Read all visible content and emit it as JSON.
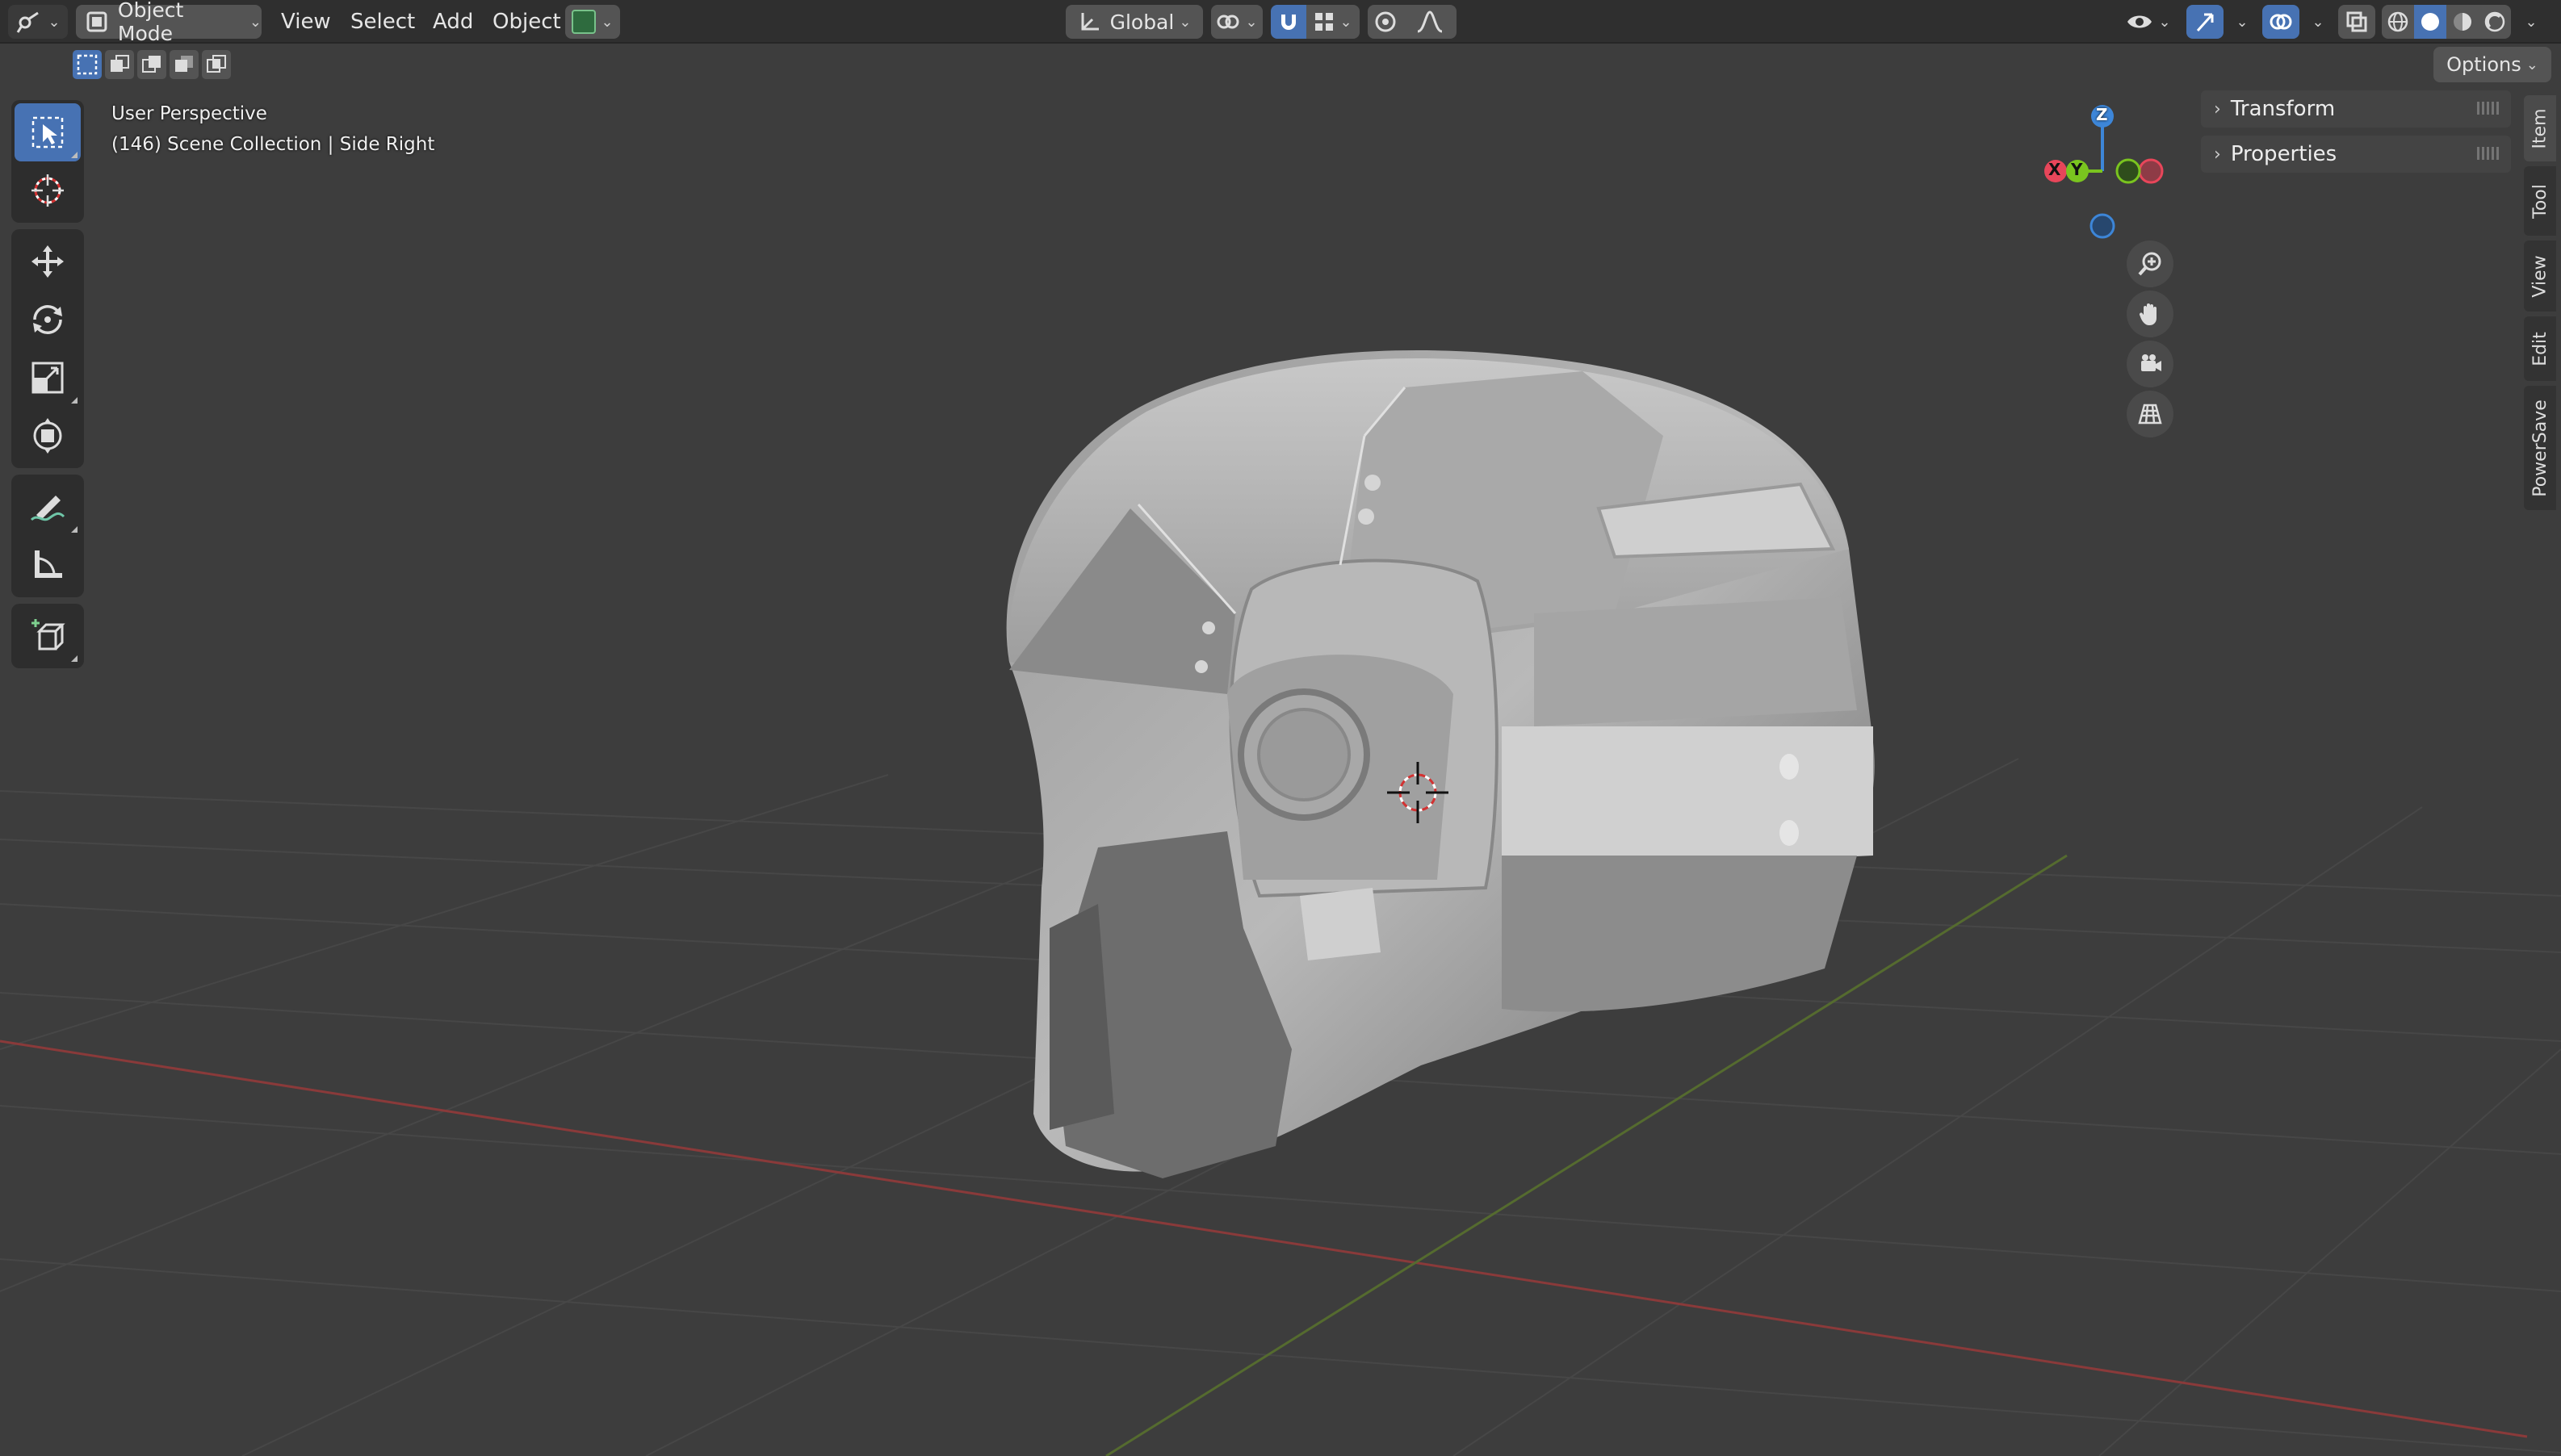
{
  "header": {
    "mode_label": "Object Mode",
    "menus": [
      "View",
      "Select",
      "Add",
      "Object"
    ],
    "orientation_label": "Global",
    "options_label": "Options"
  },
  "viewport": {
    "perspective_label": "User Perspective",
    "collection_label": "(146) Scene Collection | Side Right"
  },
  "gizmo": {
    "axes": [
      "Z",
      "Y",
      "X"
    ]
  },
  "npanel": {
    "sections": [
      "Transform",
      "Properties"
    ],
    "tabs": [
      "Item",
      "Tool",
      "View",
      "Edit",
      "PowerSave"
    ]
  },
  "colors": {
    "accent": "#4772b3",
    "x_axis": "#e8465a",
    "y_axis": "#7ac41f",
    "z_axis": "#3d86d8"
  }
}
